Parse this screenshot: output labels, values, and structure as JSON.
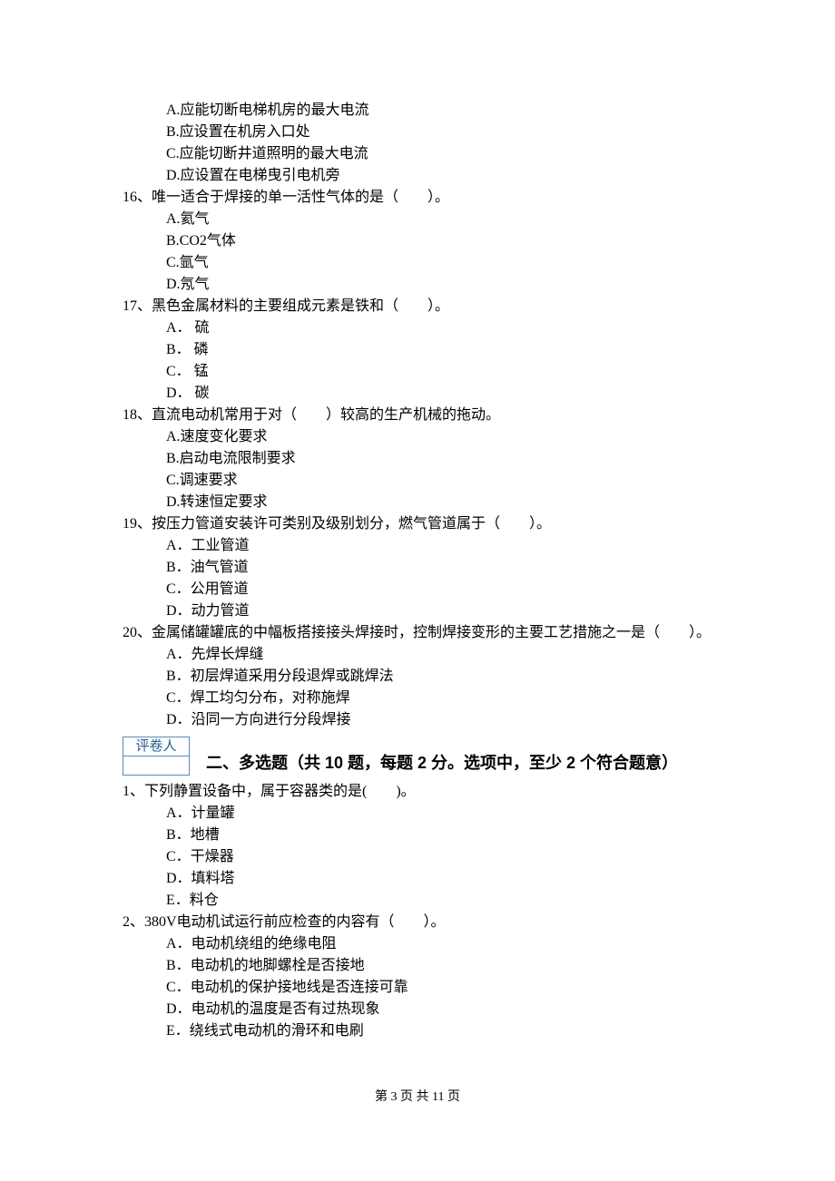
{
  "q15_tail": {
    "A": "A.应能切断电梯机房的最大电流",
    "B": "B.应设置在机房入口处",
    "C": "C.应能切断井道照明的最大电流",
    "D": "D.应设置在电梯曳引电机旁"
  },
  "q16": {
    "stem": "16、唯一适合于焊接的单一活性气体的是（　　）。",
    "A": "A.氦气",
    "B": "B.CO2气体",
    "C": "C.氩气",
    "D": "D.氖气"
  },
  "q17": {
    "stem": "17、黑色金属材料的主要组成元素是铁和（　　）。",
    "A": "A． 硫",
    "B": "B． 磷",
    "C": "C． 锰",
    "D": "D． 碳"
  },
  "q18": {
    "stem": "18、直流电动机常用于对（　　）较高的生产机械的拖动。",
    "A": "A.速度变化要求",
    "B": "B.启动电流限制要求",
    "C": "C.调速要求",
    "D": "D.转速恒定要求"
  },
  "q19": {
    "stem": "19、按压力管道安装许可类别及级别划分，燃气管道属于（　　）。",
    "A": "A．工业管道",
    "B": "B．油气管道",
    "C": "C．公用管道",
    "D": "D．动力管道"
  },
  "q20": {
    "stem": "20、金属储罐罐底的中幅板搭接接头焊接时，控制焊接变形的主要工艺措施之一是（　　）。",
    "A": "A．先焊长焊缝",
    "B": "B．初层焊道采用分段退焊或跳焊法",
    "C": "C．焊工均匀分布，对称施焊",
    "D": "D．沿同一方向进行分段焊接"
  },
  "grader_label": "评卷人",
  "section2_title": "二、多选题（共 10 题，每题 2 分。选项中，至少 2 个符合题意）",
  "mq1": {
    "stem": "1、下列静置设备中，属于容器类的是(　　)。",
    "A": "A．计量罐",
    "B": "B．地槽",
    "C": "C．干燥器",
    "D": "D．填料塔",
    "E": "E．料仓"
  },
  "mq2": {
    "stem": "2、380V电动机试运行前应检查的内容有（　　）。",
    "A": "A．电动机绕组的绝缘电阻",
    "B": "B．电动机的地脚螺栓是否接地",
    "C": "C．电动机的保护接地线是否连接可靠",
    "D": "D．电动机的温度是否有过热现象",
    "E": "E．绕线式电动机的滑环和电刷"
  },
  "footer": "第 3 页 共 11 页"
}
